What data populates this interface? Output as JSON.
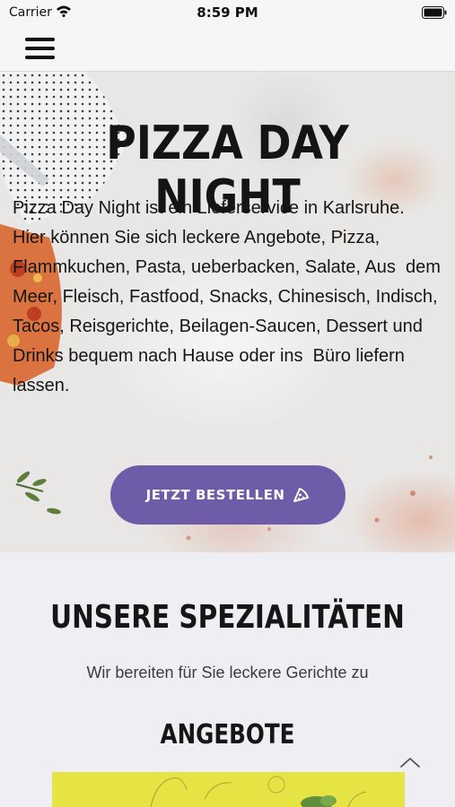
{
  "status_bar": {
    "carrier": "Carrier",
    "time": "8:59 PM"
  },
  "hero": {
    "title": "PIZZA DAY NIGHT",
    "description": "Pizza Day Night ist ein Lieferservice in Karlsruhe.\nHier können Sie sich leckere Angebote, Pizza, Flammkuchen, Pasta, ueberbacken, Salate, Aus  dem Meer, Fleisch, Fastfood, Snacks, Chinesisch, Indisch, Tacos, Reisgerichte, Beilagen-Saucen, Dessert und Drinks bequem nach Hause oder ins  Büro liefern lassen.",
    "order_button_label": "JETZT BESTELLEN"
  },
  "specials": {
    "title": "UNSERE SPEZIALITÄTEN",
    "subtitle": "Wir bereiten für Sie leckere Gerichte zu",
    "offers_title": "ANGEBOTE"
  },
  "colors": {
    "accent": "#6f5ca8",
    "offers_card": "#e6e445",
    "background": "#efeff3"
  },
  "icons": [
    "wifi-icon",
    "battery-icon",
    "menu-icon",
    "pizza-slice-icon",
    "chevron-up-icon"
  ]
}
